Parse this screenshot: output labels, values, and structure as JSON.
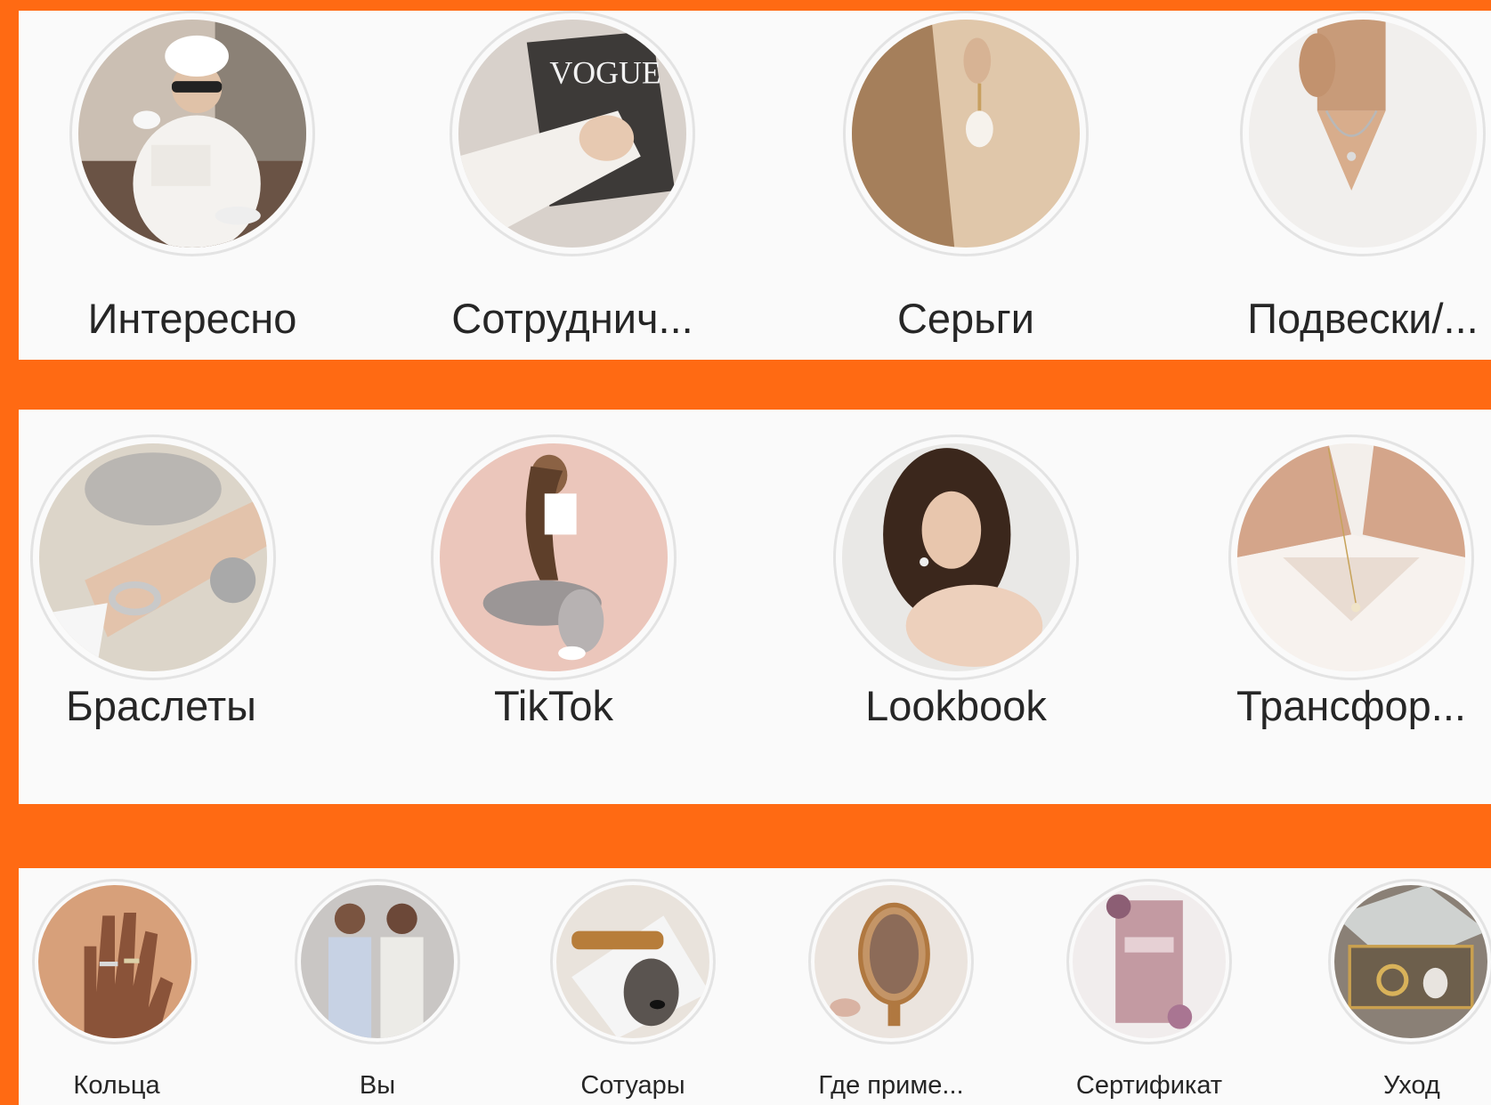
{
  "highlights_row_1": [
    {
      "label": "Интересно",
      "icon": "woman-with-coffee-photo-icon"
    },
    {
      "label": "Сотруднич...",
      "icon": "vogue-magazine-photo-icon"
    },
    {
      "label": "Серьги",
      "icon": "pearl-earring-photo-icon"
    },
    {
      "label": "Подвески/...",
      "icon": "necklace-photo-icon"
    }
  ],
  "highlights_row_2": [
    {
      "label": "Браслеты",
      "icon": "bracelet-photo-icon"
    },
    {
      "label": "TikTok",
      "icon": "tiktok-illustration-icon"
    },
    {
      "label": "Lookbook",
      "icon": "model-portrait-photo-icon"
    },
    {
      "label": "Трансфор...",
      "icon": "pendant-illustration-icon"
    }
  ],
  "highlights_row_3": [
    {
      "label": "Кольца",
      "icon": "rings-hand-photo-icon"
    },
    {
      "label": "Вы",
      "icon": "two-women-photo-icon"
    },
    {
      "label": "Сотуары",
      "icon": "sunglasses-photo-icon"
    },
    {
      "label": "Где приме...",
      "icon": "mirror-photo-icon"
    },
    {
      "label": "Сертификат",
      "icon": "gift-certificate-photo-icon"
    },
    {
      "label": "Уход",
      "icon": "jewelry-box-photo-icon"
    }
  ],
  "colors": {
    "background": "#ff6a13",
    "panel": "#fafafa",
    "ring": "#e3e3e3",
    "text": "#262626"
  }
}
